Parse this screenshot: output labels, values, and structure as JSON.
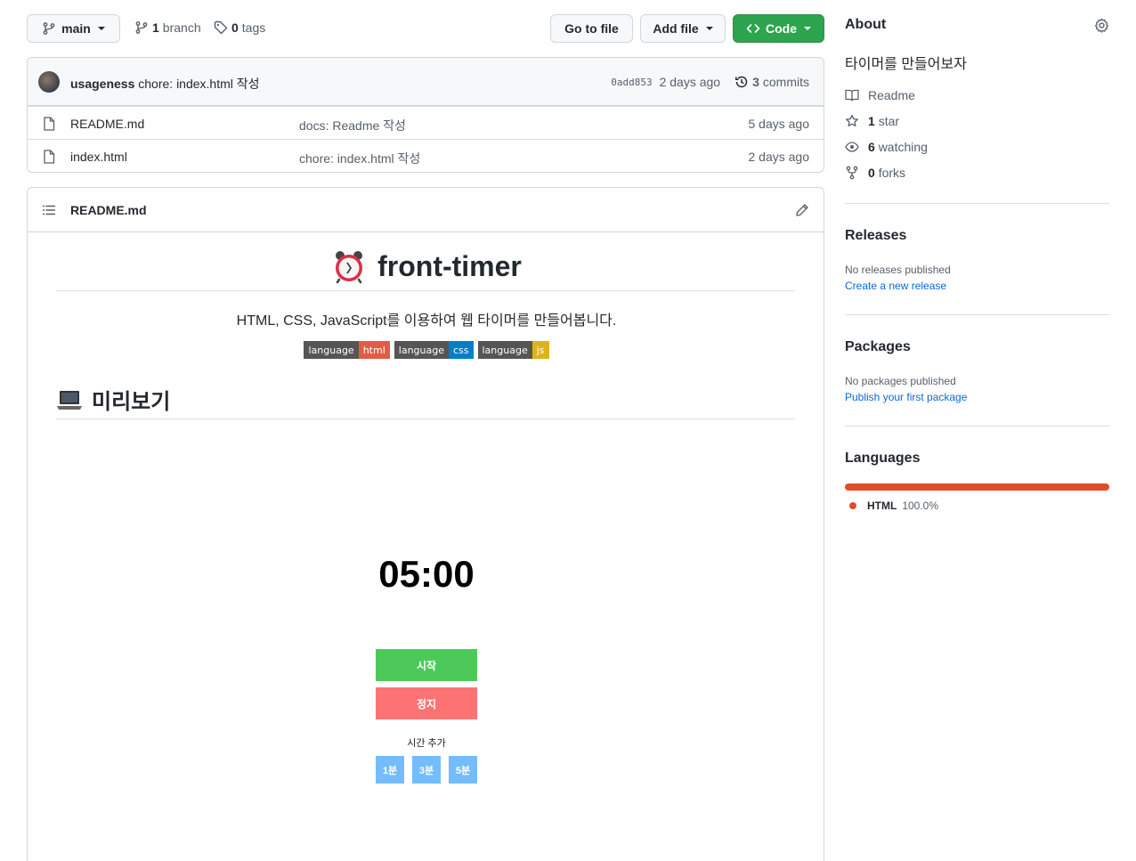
{
  "toolbar": {
    "branch_name": "main",
    "branch_count": "1",
    "branch_label": "branch",
    "tag_count": "0",
    "tag_label": "tags",
    "go_to_file": "Go to file",
    "add_file": "Add file",
    "code": "Code"
  },
  "commit": {
    "author": "usageness",
    "message": "chore: index.html 작성",
    "hash": "0add853",
    "time": "2 days ago",
    "count": "3",
    "count_label": "commits"
  },
  "files": [
    {
      "name": "README.md",
      "message": "docs: Readme 작성",
      "time": "5 days ago"
    },
    {
      "name": "index.html",
      "message": "chore: index.html 작성",
      "time": "2 days ago"
    }
  ],
  "readme": {
    "filename": "README.md",
    "title": "front-timer",
    "description": "HTML, CSS, JavaScript를 이용하여 웹 타이머를 만들어봅니다.",
    "badges": [
      {
        "label": "language",
        "value": "html",
        "color": "#e05d44"
      },
      {
        "label": "language",
        "value": "css",
        "color": "#007ec6"
      },
      {
        "label": "language",
        "value": "js",
        "color": "#dfb317"
      }
    ],
    "preview_heading": "미리보기",
    "timer": {
      "display": "05:00",
      "start_label": "시작",
      "stop_label": "정지",
      "add_time_label": "시간 추가",
      "add_options": [
        "1분",
        "3분",
        "5분"
      ]
    }
  },
  "about": {
    "heading": "About",
    "description": "타이머를 만들어보자",
    "readme": "Readme",
    "stars": "1",
    "stars_label": "star",
    "watching": "6",
    "watching_label": "watching",
    "forks": "0",
    "forks_label": "forks"
  },
  "releases": {
    "heading": "Releases",
    "empty": "No releases published",
    "link": "Create a new release"
  },
  "packages": {
    "heading": "Packages",
    "empty": "No packages published",
    "link": "Publish your first package"
  },
  "languages": {
    "heading": "Languages",
    "items": [
      {
        "name": "HTML",
        "percent": "100.0%",
        "color": "#e34c26"
      }
    ]
  },
  "colors": {
    "code_button": "#2da44e",
    "start_button": "#4dc95a",
    "stop_button": "#fd7373",
    "add_button": "#74bcfc"
  }
}
